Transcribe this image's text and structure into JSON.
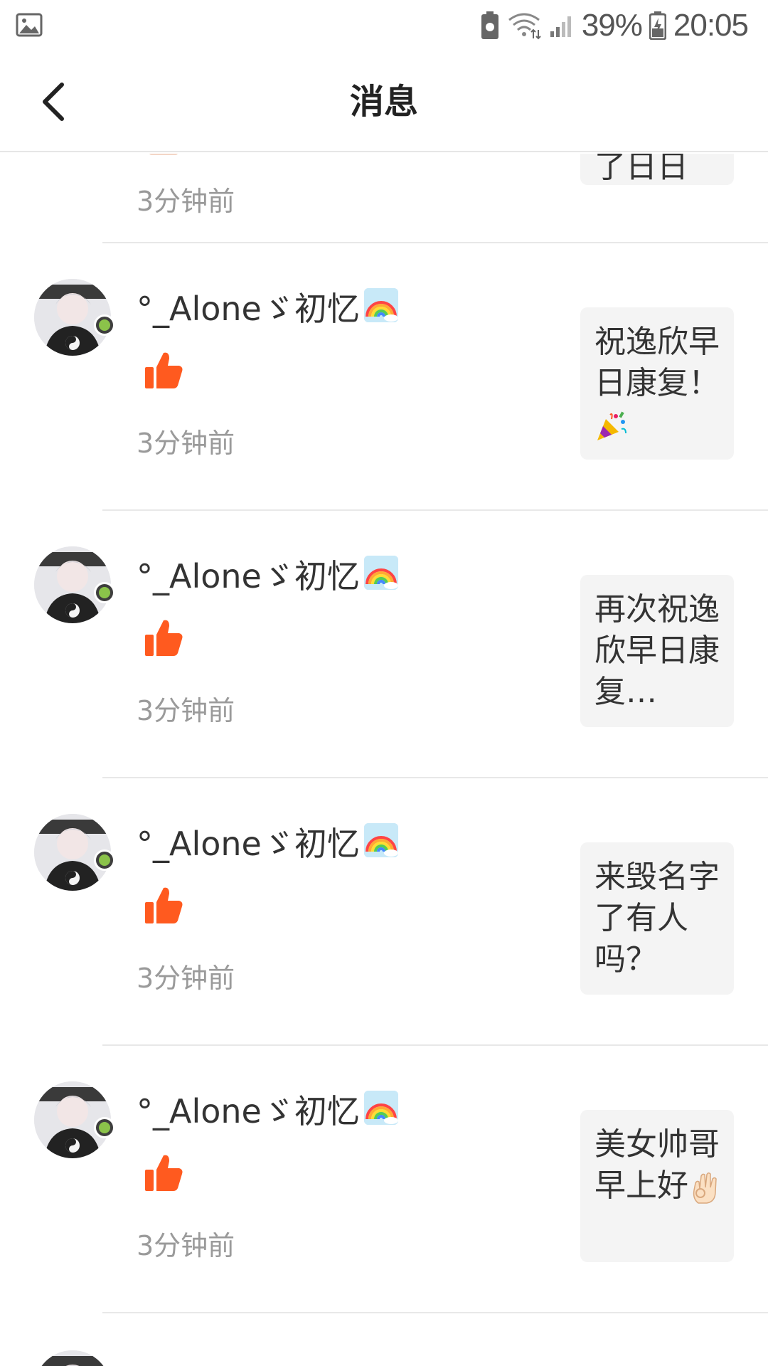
{
  "status_bar": {
    "battery_percent": "39%",
    "time": "20:05"
  },
  "header": {
    "title": "消息"
  },
  "partial_top_item": {
    "time": "3分钟前",
    "preview_text": "了日日"
  },
  "messages": [
    {
      "username": "°_Aloneゞ初忆",
      "time": "3分钟前",
      "preview": "祝逸欣早日康复！",
      "preview_emoji": "party-popper-icon"
    },
    {
      "username": "°_Aloneゞ初忆",
      "time": "3分钟前",
      "preview": "再次祝逸欣早日康复…",
      "preview_emoji": ""
    },
    {
      "username": "°_Aloneゞ初忆",
      "time": "3分钟前",
      "preview": "来毁名字了有人吗？",
      "preview_emoji": ""
    },
    {
      "username": "°_Aloneゞ初忆",
      "time": "3分钟前",
      "preview": "美女帅哥早上好",
      "preview_emoji": "ok-hand-icon"
    }
  ],
  "colors": {
    "like": "#ff5a1f",
    "divider": "#e8e8e8",
    "time_text": "#9a9a9a",
    "preview_bg": "#f4f4f4"
  }
}
